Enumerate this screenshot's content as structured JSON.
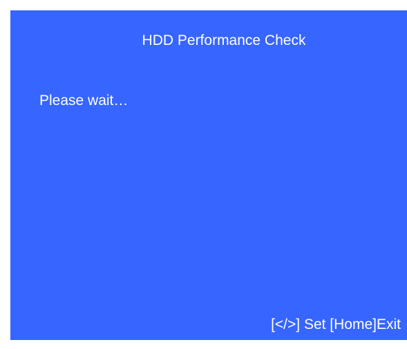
{
  "screen": {
    "title": "HDD Performance Check",
    "status": "Please wait…",
    "footer_hint": "[</>] Set [Home]Exit",
    "background_color": "#3665FF",
    "text_color": "#FFFFFF"
  }
}
